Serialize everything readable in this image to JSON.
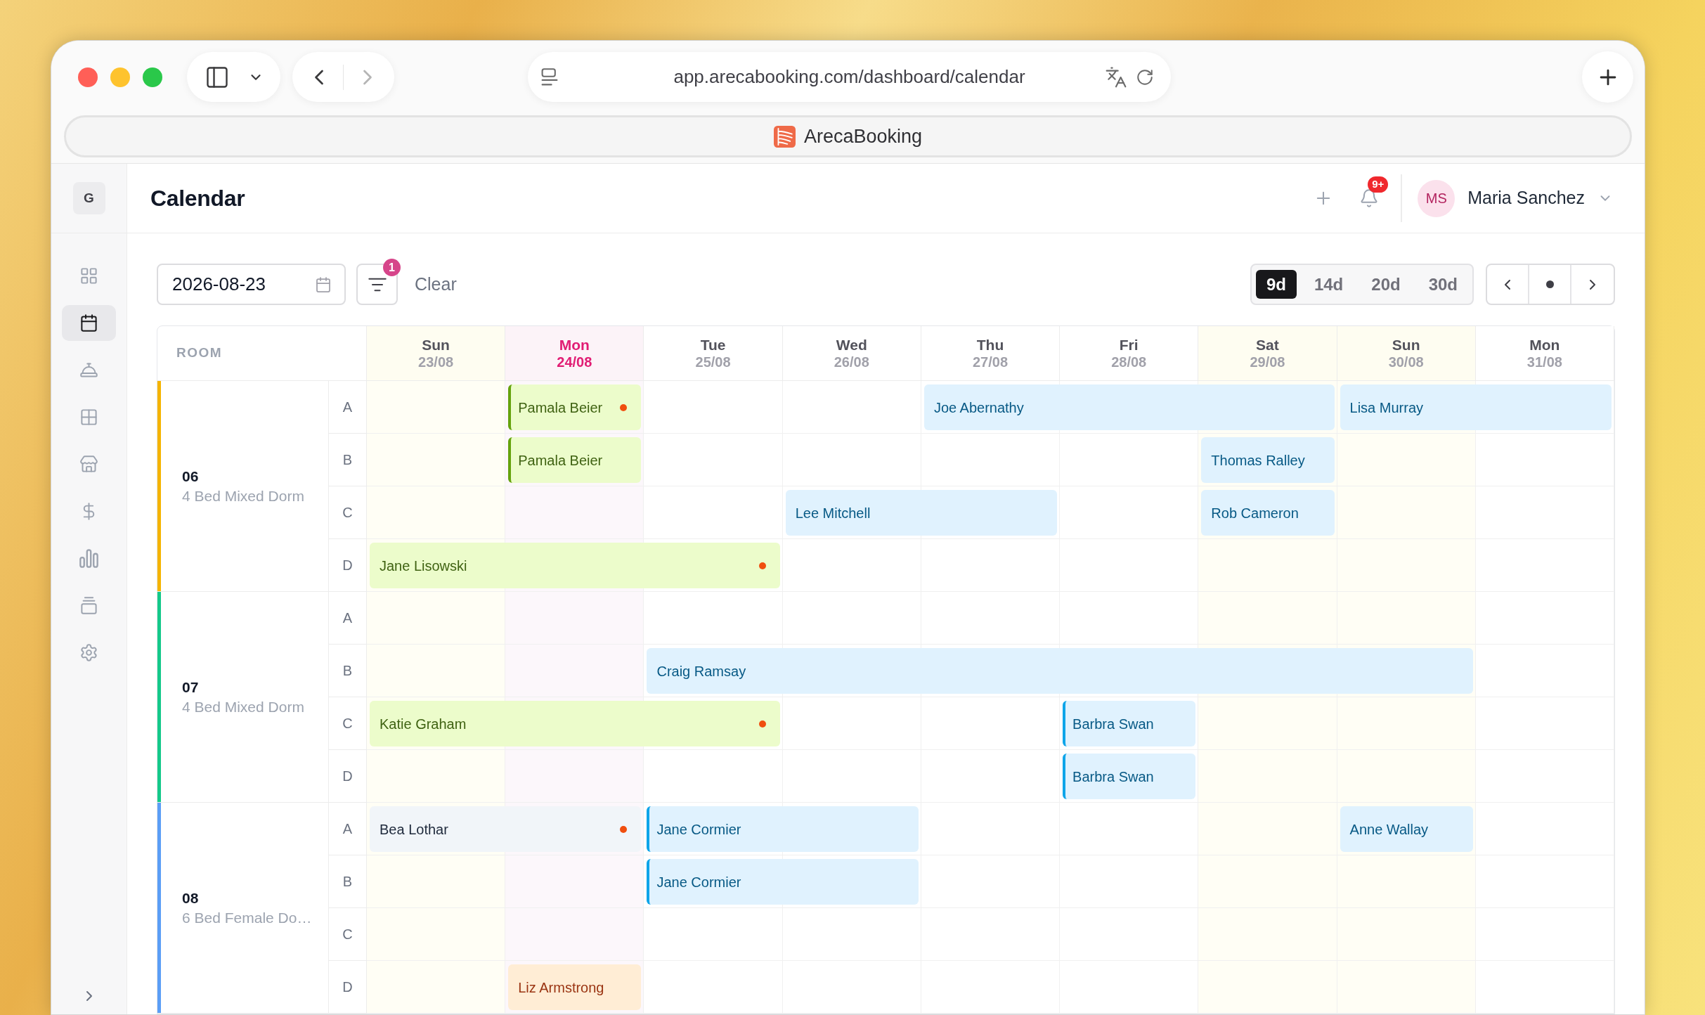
{
  "browser": {
    "url": "app.arecabooking.com/dashboard/calendar",
    "tab_title": "ArecaBooking",
    "back_disabled": false,
    "forward_disabled": true
  },
  "sidebar": {
    "workspace": "G",
    "items": [
      {
        "selected": false
      },
      {
        "selected": true
      },
      {
        "selected": false
      },
      {
        "selected": false
      },
      {
        "selected": false
      },
      {
        "selected": false
      },
      {
        "selected": false
      },
      {
        "selected": false
      },
      {
        "selected": false
      }
    ]
  },
  "header": {
    "title": "Calendar",
    "notification_count": "9+",
    "user": {
      "initials": "MS",
      "name": "Maria Sanchez"
    }
  },
  "toolbar": {
    "date": "2026-08-23",
    "filter_count": "1",
    "clear_label": "Clear",
    "ranges": [
      {
        "label": "9d",
        "selected": true
      },
      {
        "label": "14d",
        "selected": false
      },
      {
        "label": "20d",
        "selected": false
      },
      {
        "label": "30d",
        "selected": false
      }
    ]
  },
  "calendar": {
    "room_heading": "ROOM",
    "days": [
      {
        "weekday": "Sun",
        "date": "23/08",
        "weekend": true,
        "today": false
      },
      {
        "weekday": "Mon",
        "date": "24/08",
        "weekend": false,
        "today": true
      },
      {
        "weekday": "Tue",
        "date": "25/08",
        "weekend": false,
        "today": false
      },
      {
        "weekday": "Wed",
        "date": "26/08",
        "weekend": false,
        "today": false
      },
      {
        "weekday": "Thu",
        "date": "27/08",
        "weekend": false,
        "today": false
      },
      {
        "weekday": "Fri",
        "date": "28/08",
        "weekend": false,
        "today": false
      },
      {
        "weekday": "Sat",
        "date": "29/08",
        "weekend": true,
        "today": false
      },
      {
        "weekday": "Sun",
        "date": "30/08",
        "weekend": true,
        "today": false
      },
      {
        "weekday": "Mon",
        "date": "31/08",
        "weekend": false,
        "today": false
      }
    ],
    "rooms": [
      {
        "number": "06",
        "type": "4 Bed Mixed Dorm",
        "color": "#f5b400",
        "beds": [
          {
            "label": "A",
            "cells": [
              {
                "kind": "free"
              },
              {
                "kind": "booking",
                "guest": "Pamala Beier",
                "color": "#ecfccb",
                "accent": true,
                "alert": true
              },
              {
                "kind": "free"
              },
              {
                "kind": "free"
              },
              {
                "kind": "booking",
                "guest": "Joe Abernathy",
                "color": "#e0f2fe",
                "accent": false,
                "alert": false
              },
              {
                "kind": "continued"
              },
              {
                "kind": "continued"
              },
              {
                "kind": "booking",
                "guest": "Lisa Murray",
                "color": "#e0f2fe",
                "accent": false,
                "alert": false
              },
              {
                "kind": "continued"
              }
            ]
          },
          {
            "label": "B",
            "cells": [
              {
                "kind": "free"
              },
              {
                "kind": "booking",
                "guest": "Pamala Beier",
                "color": "#ecfccb",
                "accent": true,
                "alert": false
              },
              {
                "kind": "free"
              },
              {
                "kind": "free"
              },
              {
                "kind": "free"
              },
              {
                "kind": "free"
              },
              {
                "kind": "booking",
                "guest": "Thomas Ralley",
                "color": "#e0f2fe",
                "accent": false,
                "alert": false
              },
              {
                "kind": "free"
              },
              {
                "kind": "free"
              }
            ]
          },
          {
            "label": "C",
            "cells": [
              {
                "kind": "free"
              },
              {
                "kind": "free"
              },
              {
                "kind": "free"
              },
              {
                "kind": "booking",
                "guest": "Lee Mitchell",
                "color": "#e0f2fe",
                "accent": false,
                "alert": false
              },
              {
                "kind": "continued"
              },
              {
                "kind": "free"
              },
              {
                "kind": "booking",
                "guest": "Rob Cameron",
                "color": "#e0f2fe",
                "accent": false,
                "alert": false
              },
              {
                "kind": "free"
              },
              {
                "kind": "free"
              }
            ]
          },
          {
            "label": "D",
            "cells": [
              {
                "kind": "booking",
                "guest": "Jane Lisowski",
                "color": "#ecfccb",
                "accent": false,
                "alert": true
              },
              {
                "kind": "continued"
              },
              {
                "kind": "continued"
              },
              {
                "kind": "free"
              },
              {
                "kind": "free"
              },
              {
                "kind": "free"
              },
              {
                "kind": "free"
              },
              {
                "kind": "free"
              },
              {
                "kind": "free"
              }
            ]
          }
        ]
      },
      {
        "number": "07",
        "type": "4 Bed Mixed Dorm",
        "color": "#14c98a",
        "beds": [
          {
            "label": "A",
            "cells": [
              {
                "kind": "free"
              },
              {
                "kind": "free"
              },
              {
                "kind": "free"
              },
              {
                "kind": "free"
              },
              {
                "kind": "free"
              },
              {
                "kind": "free"
              },
              {
                "kind": "free"
              },
              {
                "kind": "free"
              },
              {
                "kind": "free"
              }
            ]
          },
          {
            "label": "B",
            "cells": [
              {
                "kind": "free"
              },
              {
                "kind": "free"
              },
              {
                "kind": "booking",
                "guest": "Craig Ramsay",
                "color": "#e0f2fe",
                "accent": false,
                "alert": false
              },
              {
                "kind": "continued"
              },
              {
                "kind": "continued"
              },
              {
                "kind": "continued"
              },
              {
                "kind": "continued"
              },
              {
                "kind": "continued"
              },
              {
                "kind": "free"
              }
            ]
          },
          {
            "label": "C",
            "cells": [
              {
                "kind": "booking",
                "guest": "Katie Graham",
                "color": "#ecfccb",
                "accent": false,
                "alert": true
              },
              {
                "kind": "continued"
              },
              {
                "kind": "continued"
              },
              {
                "kind": "free"
              },
              {
                "kind": "free"
              },
              {
                "kind": "booking",
                "guest": "Barbra Swan",
                "color": "#e0f2fe",
                "accent": true,
                "alert": false
              },
              {
                "kind": "free"
              },
              {
                "kind": "free"
              },
              {
                "kind": "free"
              }
            ]
          },
          {
            "label": "D",
            "cells": [
              {
                "kind": "free"
              },
              {
                "kind": "free"
              },
              {
                "kind": "free"
              },
              {
                "kind": "free"
              },
              {
                "kind": "free"
              },
              {
                "kind": "booking",
                "guest": "Barbra Swan",
                "color": "#e0f2fe",
                "accent": true,
                "alert": false
              },
              {
                "kind": "free"
              },
              {
                "kind": "free"
              },
              {
                "kind": "free"
              }
            ]
          }
        ]
      },
      {
        "number": "08",
        "type": "6 Bed Female Do…",
        "color": "#5b9ef6",
        "beds": [
          {
            "label": "A",
            "cells": [
              {
                "kind": "booking",
                "guest": "Bea Lothar",
                "color": "#f1f5f9",
                "accent": false,
                "alert": true
              },
              {
                "kind": "continued"
              },
              {
                "kind": "booking",
                "guest": "Jane Cormier",
                "color": "#e0f2fe",
                "accent": true,
                "alert": false
              },
              {
                "kind": "continued"
              },
              {
                "kind": "free"
              },
              {
                "kind": "free"
              },
              {
                "kind": "free"
              },
              {
                "kind": "booking",
                "guest": "Anne Wallay",
                "color": "#e0f2fe",
                "accent": false,
                "alert": false
              },
              {
                "kind": "free"
              }
            ]
          },
          {
            "label": "B",
            "cells": [
              {
                "kind": "free"
              },
              {
                "kind": "free"
              },
              {
                "kind": "booking",
                "guest": "Jane Cormier",
                "color": "#e0f2fe",
                "accent": true,
                "alert": false
              },
              {
                "kind": "continued"
              },
              {
                "kind": "free"
              },
              {
                "kind": "free"
              },
              {
                "kind": "free"
              },
              {
                "kind": "free"
              },
              {
                "kind": "free"
              }
            ]
          },
          {
            "label": "C",
            "cells": [
              {
                "kind": "free"
              },
              {
                "kind": "free"
              },
              {
                "kind": "free"
              },
              {
                "kind": "free"
              },
              {
                "kind": "free"
              },
              {
                "kind": "free"
              },
              {
                "kind": "free"
              },
              {
                "kind": "free"
              },
              {
                "kind": "free"
              }
            ]
          },
          {
            "label": "D",
            "cells": [
              {
                "kind": "free"
              },
              {
                "kind": "booking",
                "guest": "Liz Armstrong",
                "color": "#ffedd5",
                "accent": false,
                "alert": false
              },
              {
                "kind": "free"
              },
              {
                "kind": "free"
              },
              {
                "kind": "free"
              },
              {
                "kind": "free"
              },
              {
                "kind": "free"
              },
              {
                "kind": "free"
              },
              {
                "kind": "free"
              }
            ]
          }
        ]
      }
    ]
  }
}
